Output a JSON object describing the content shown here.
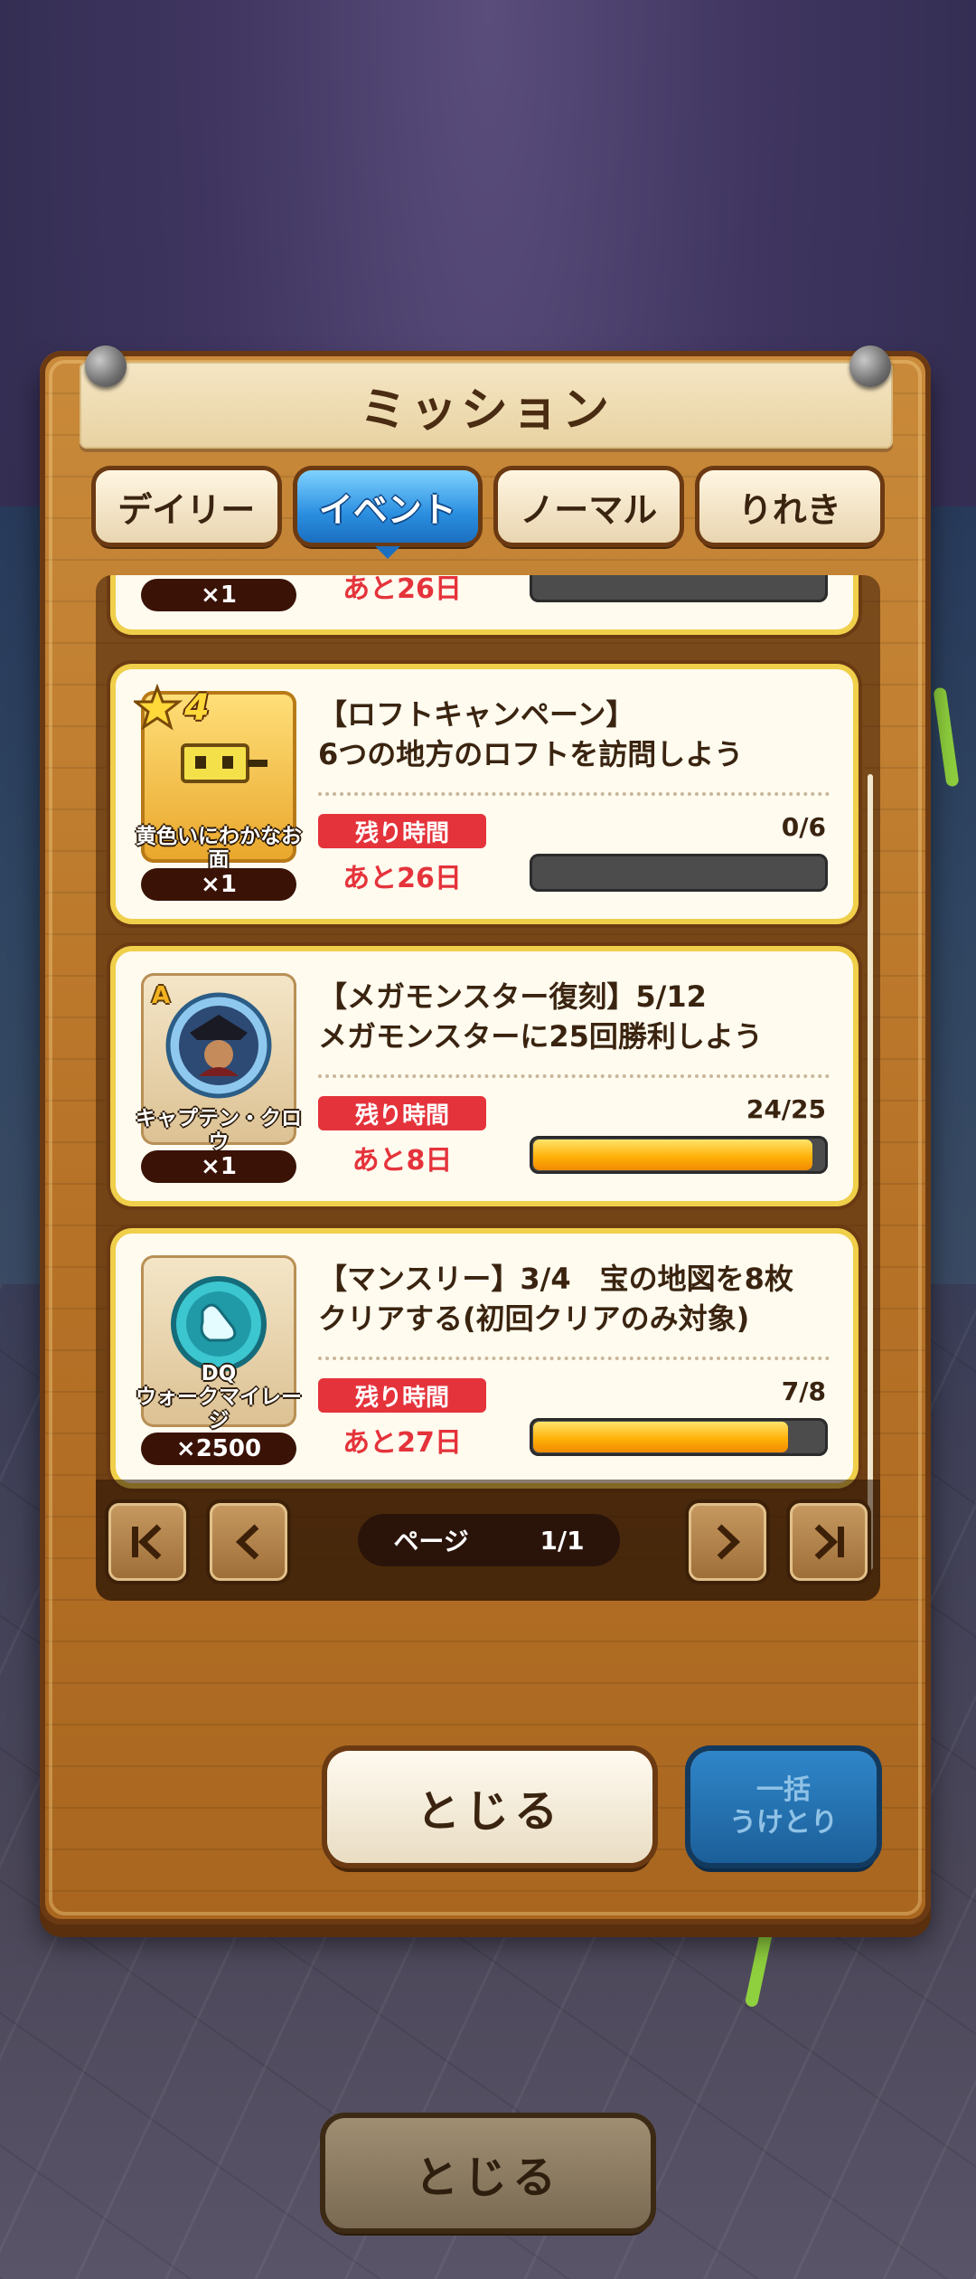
{
  "panel": {
    "title": "ミッション",
    "tabs": [
      {
        "label": "デイリー",
        "active": false
      },
      {
        "label": "イベント",
        "active": true
      },
      {
        "label": "ノーマル",
        "active": false
      },
      {
        "label": "りれき",
        "active": false
      }
    ]
  },
  "missions": [
    {
      "reward_name": "",
      "reward_qty": "×1",
      "text_line1": "",
      "text_line2": "",
      "remain_label": "",
      "remain_days": "あと26日",
      "progress_text": "",
      "progress_ratio": 0
    },
    {
      "reward_name": "黄色いにわかなお面",
      "reward_qty": "×1",
      "star": "4",
      "text_line1": "【ロフトキャンペーン】",
      "text_line2": "6つの地方のロフトを訪問しよう",
      "remain_label": "残り時間",
      "remain_days": "あと26日",
      "progress_text": "0/6",
      "progress_ratio": 0
    },
    {
      "reward_name": "キャプテン・クロウ",
      "rank": "A",
      "reward_qty": "×1",
      "text_line1": "【メガモンスター復刻】5/12",
      "text_line2": "メガモンスターに25回勝利しよう",
      "remain_label": "残り時間",
      "remain_days": "あと8日",
      "progress_text": "24/25",
      "progress_ratio": 0.96
    },
    {
      "reward_name_line1": "DQ",
      "reward_name_line2": "ウォークマイレージ",
      "reward_qty": "×2500",
      "text_line1": "【マンスリー】3/4　宝の地図を8枚",
      "text_line2": "クリアする(初回クリアのみ対象)",
      "remain_label": "残り時間",
      "remain_days": "あと27日",
      "progress_text": "7/8",
      "progress_ratio": 0.875
    }
  ],
  "pager": {
    "label": "ページ",
    "value": "1/1"
  },
  "buttons": {
    "close": "とじる",
    "bulk_line1": "一括",
    "bulk_line2": "うけとり",
    "bottom_close": "とじる"
  },
  "icons": {
    "first": "first-page-icon",
    "prev": "prev-page-icon",
    "next": "next-page-icon",
    "last": "last-page-icon"
  }
}
